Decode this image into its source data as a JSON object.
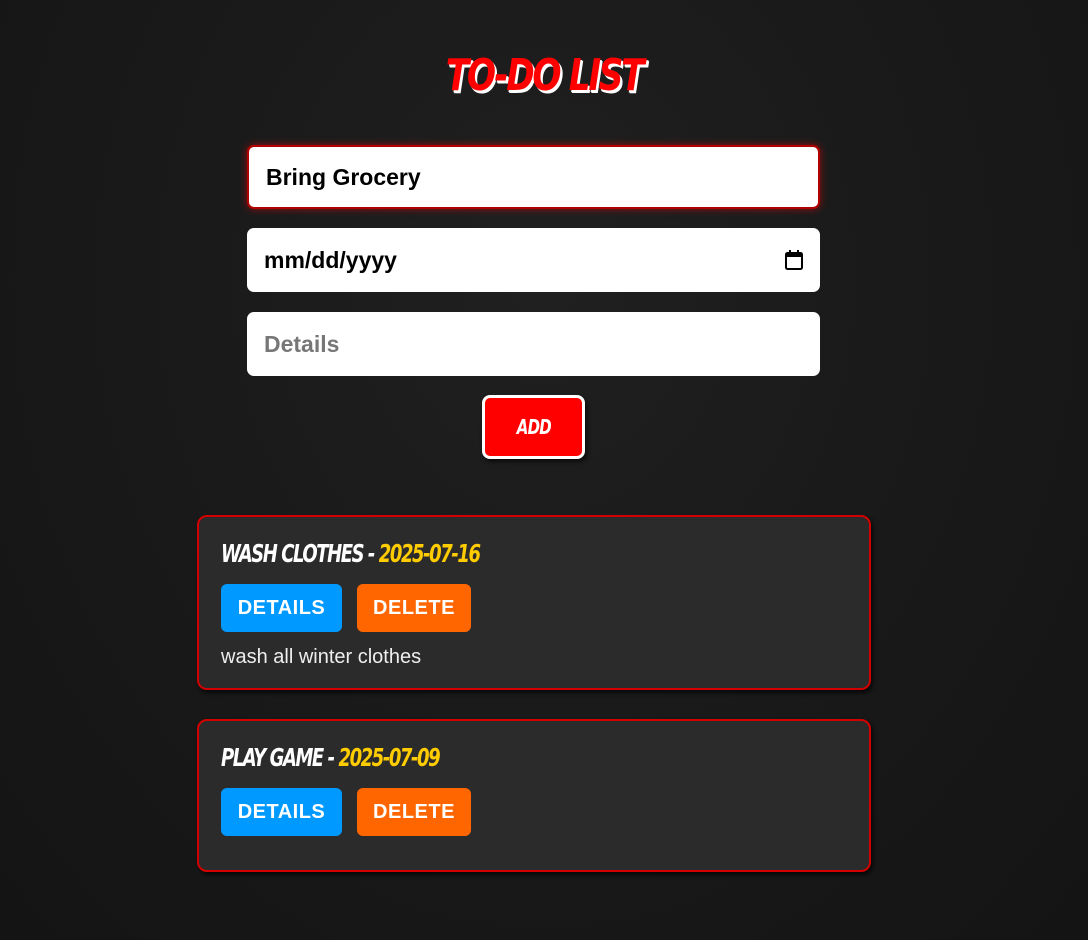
{
  "app": {
    "title": "TO-DO LIST",
    "accent_color": "#ff0000"
  },
  "form": {
    "task_value": "Bring Grocery",
    "date_placeholder": "mm/dd/yyyy",
    "date_icon": "calendar-icon",
    "details_placeholder": "Details",
    "add_label": "ADD"
  },
  "todos": [
    {
      "name": "WASH CLOTHES",
      "separator": " - ",
      "date": "2025-07-16",
      "details_label": "DETAILS",
      "delete_label": "DELETE",
      "note": "wash all winter clothes"
    },
    {
      "name": "PLAY GAME",
      "separator": " - ",
      "date": "2025-07-09",
      "details_label": "DETAILS",
      "delete_label": "DELETE"
    }
  ],
  "colors": {
    "details_button": "#0099ff",
    "delete_button": "#ff6600",
    "date_text": "#ffcc00",
    "card_border": "#d40000"
  }
}
